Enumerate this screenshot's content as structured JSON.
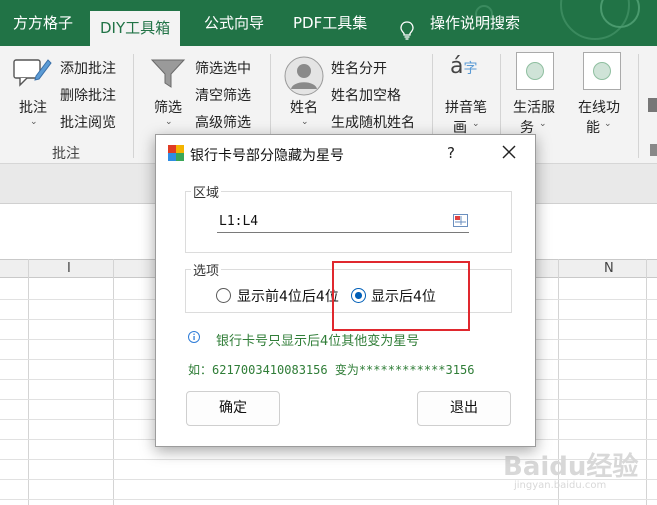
{
  "tabs": [
    {
      "label": "方方格子",
      "active": false
    },
    {
      "label": "DIY工具箱",
      "active": true
    },
    {
      "label": "公式向导",
      "active": false
    },
    {
      "label": "PDF工具集",
      "active": false
    }
  ],
  "search_tab": {
    "icon": "lightbulb-icon",
    "label": "操作说明搜索"
  },
  "ribbon": {
    "annotate": {
      "big_label": "批注",
      "items": [
        "添加批注",
        "删除批注",
        "批注阅览"
      ],
      "group_label": "批注"
    },
    "filter": {
      "big_label": "筛选",
      "items": [
        "筛选选中",
        "清空筛选",
        "高级筛选"
      ]
    },
    "name": {
      "big_label": "姓名",
      "items": [
        "姓名分开",
        "姓名加空格",
        "生成随机姓名"
      ]
    },
    "pinyin": {
      "label_line1": "拼音笔",
      "label_line2": "画"
    },
    "life": {
      "label_line1": "生活服",
      "label_line2": "务"
    },
    "online": {
      "label_line1": "在线功",
      "label_line2": "能"
    }
  },
  "sheet": {
    "column_headers": [
      "I",
      "N"
    ]
  },
  "dialog": {
    "title": "银行卡号部分隐藏为星号",
    "help": "?",
    "area_group_label": "区域",
    "range_value": "L1:L4",
    "options_group_label": "选项",
    "options": [
      {
        "label": "显示前4位后4位",
        "selected": false
      },
      {
        "label": "显示后4位",
        "selected": true
      }
    ],
    "hint": "银行卡号只显示后4位其他变为星号",
    "example": "如：6217003410083156 变为************3156",
    "ok_label": "确定",
    "exit_label": "退出"
  },
  "watermark": {
    "brand": "Baidu经验",
    "url": "jingyan.baidu.com"
  },
  "colors": {
    "excel_green": "#217346",
    "accent_blue": "#005fb8",
    "hint_green": "#2f7d37",
    "highlight_red": "#e0282e"
  }
}
